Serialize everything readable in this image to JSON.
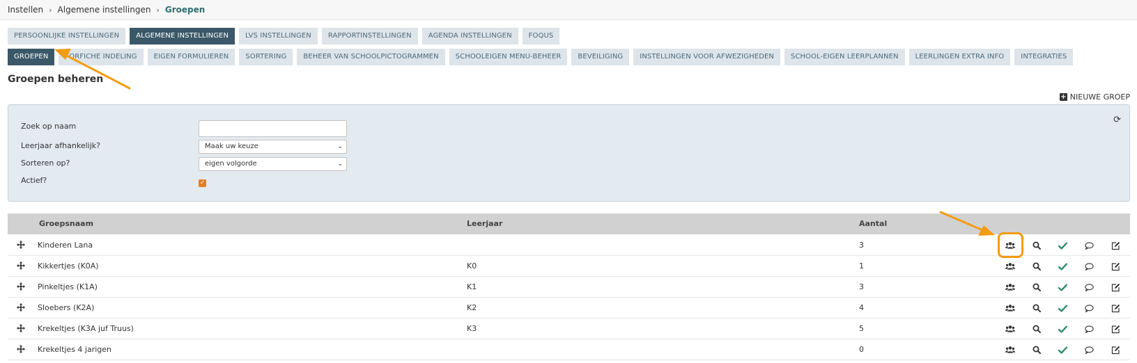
{
  "breadcrumb": [
    {
      "label": "Instellen",
      "active": false
    },
    {
      "label": "Algemene instellingen",
      "active": false
    },
    {
      "label": "Groepen",
      "active": true
    }
  ],
  "tabs_row1": [
    {
      "label": "PERSOONLIJKE INSTELLINGEN",
      "active": false
    },
    {
      "label": "ALGEMENE INSTELLINGEN",
      "active": true
    },
    {
      "label": "LVS INSTELLINGEN",
      "active": false
    },
    {
      "label": "RAPPORTINSTELLINGEN",
      "active": false
    },
    {
      "label": "AGENDA INSTELLINGEN",
      "active": false
    },
    {
      "label": "FOQUS",
      "active": false
    }
  ],
  "tabs_row2": [
    {
      "label": "GROEPEN",
      "active": true
    },
    {
      "label": "FORFICHE INDELING",
      "active": false
    },
    {
      "label": "EIGEN FORMULIEREN",
      "active": false
    },
    {
      "label": "SORTERING",
      "active": false
    },
    {
      "label": "BEHEER VAN SCHOOLPICTOGRAMMEN",
      "active": false
    },
    {
      "label": "SCHOOLEIGEN MENU-BEHEER",
      "active": false
    },
    {
      "label": "BEVEILIGING",
      "active": false
    },
    {
      "label": "INSTELLINGEN VOOR AFWEZIGHEDEN",
      "active": false
    },
    {
      "label": "SCHOOL-EIGEN LEERPLANNEN",
      "active": false
    },
    {
      "label": "LEERLINGEN EXTRA INFO",
      "active": false
    },
    {
      "label": "INTEGRATIES",
      "active": false
    }
  ],
  "page": {
    "heading": "Groepen beheren",
    "new_group_label": "NIEUWE GROEP"
  },
  "filter": {
    "search_label": "Zoek op naam",
    "search_value": "",
    "grade_label": "Leerjaar afhankelijk?",
    "grade_value": "Maak uw keuze",
    "sort_label": "Sorteren op?",
    "sort_value": "eigen volgorde",
    "active_label": "Actief?",
    "active_checked": true
  },
  "table": {
    "headers": {
      "name": "Groepsnaam",
      "grade": "Leerjaar",
      "count": "Aantal"
    },
    "rows": [
      {
        "name": "Kinderen Lana",
        "grade": "",
        "count": "3"
      },
      {
        "name": "Kikkertjes (K0A)",
        "grade": "K0",
        "count": "1"
      },
      {
        "name": "Pinkeltjes (K1A)",
        "grade": "K1",
        "count": "3"
      },
      {
        "name": "Sloebers (K2A)",
        "grade": "K2",
        "count": "4"
      },
      {
        "name": "Krekeltjes (K3A juf Truus)",
        "grade": "K3",
        "count": "5"
      },
      {
        "name": "Krekeltjes 4 jarigen",
        "grade": "",
        "count": "0"
      }
    ]
  },
  "icons": {
    "move": "move-icon",
    "members": "users-icon",
    "view": "search-icon",
    "active": "check-icon",
    "comment": "comment-icon",
    "edit": "edit-icon"
  },
  "colors": {
    "active_tab": "#3b5869",
    "tab": "#dde4ea",
    "annotation": "#f39c12",
    "check": "#2e8b6e",
    "checkbox": "#e67e22"
  }
}
